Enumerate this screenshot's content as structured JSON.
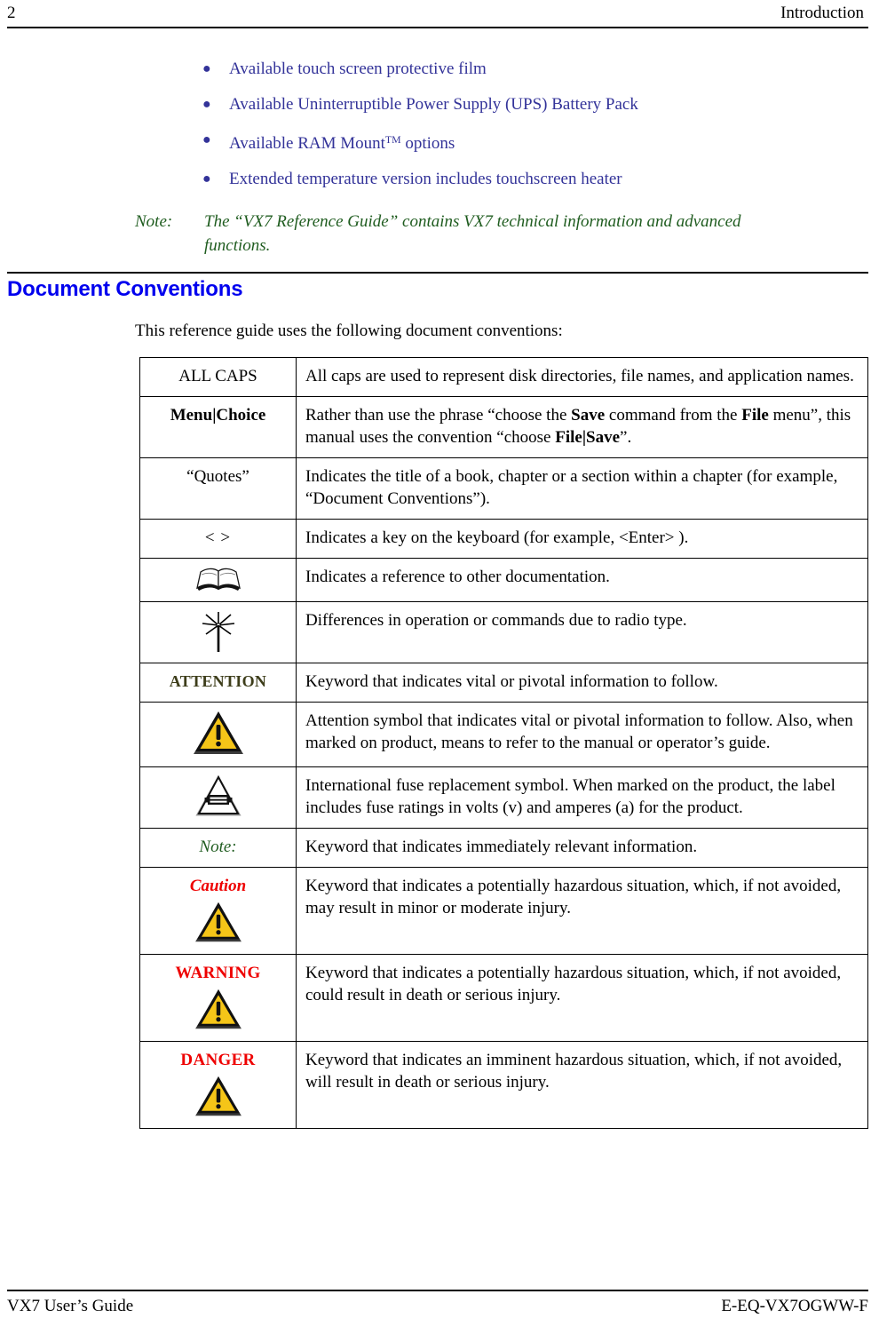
{
  "header": {
    "page_number": "2",
    "chapter_title": "Introduction"
  },
  "bullets": [
    {
      "text": "Available touch screen protective film"
    },
    {
      "text": "Available Uninterruptible Power Supply (UPS) Battery Pack"
    },
    {
      "text": "Available RAM Mount",
      "sup": "TM",
      "text_after": " options"
    },
    {
      "text": "Extended temperature version includes touchscreen heater"
    }
  ],
  "note": {
    "label": "Note:",
    "line1": "The “VX7 Reference Guide” contains VX7 technical information and advanced",
    "line2": "functions."
  },
  "section": {
    "heading": "Document Conventions",
    "intro": "This reference guide uses the following document conventions:"
  },
  "table": {
    "rows": [
      {
        "term": "ALL CAPS",
        "term_style": "plain",
        "icon": null,
        "desc": "All caps are used to represent disk directories, file names, and application names."
      },
      {
        "term": "Menu|Choice",
        "term_style": "bold",
        "icon": null,
        "desc": "Rather than use the phrase “choose the Save command from the File menu”, this manual uses the convention “choose File|Save”.",
        "desc_rich": [
          {
            "t": "Rather than use the phrase “choose the "
          },
          {
            "t": "Save",
            "b": true
          },
          {
            "t": " command from the "
          },
          {
            "t": "File",
            "b": true
          },
          {
            "t": " menu”, this manual uses the convention “choose "
          },
          {
            "t": "File|Save",
            "b": true
          },
          {
            "t": "”."
          }
        ]
      },
      {
        "term": "“Quotes”",
        "term_style": "plain",
        "icon": null,
        "desc": "Indicates the title of a book, chapter or a section within a chapter (for example, “Document Conventions”)."
      },
      {
        "term": "<     >",
        "term_style": "keys",
        "icon": null,
        "desc": "Indicates a key on the keyboard (for example, <Enter> )."
      },
      {
        "term": "",
        "term_style": "plain",
        "icon": "open-book-icon",
        "desc": "Indicates a reference to other documentation."
      },
      {
        "term": "",
        "term_style": "plain",
        "icon": "radio-antenna-icon",
        "desc": "Differences in operation or commands due to radio type."
      },
      {
        "term": "ATTENTION",
        "term_style": "attention",
        "icon": null,
        "desc": "Keyword that indicates vital or pivotal information to follow."
      },
      {
        "term": "",
        "term_style": "plain",
        "icon": "warning-triangle-icon",
        "desc": "Attention symbol that indicates vital or pivotal information to follow. Also, when marked on product, means to refer to the manual or operator’s guide."
      },
      {
        "term": "",
        "term_style": "plain",
        "icon": "fuse-triangle-icon",
        "desc": "International fuse replacement symbol. When marked on the product, the label includes fuse ratings in volts (v) and amperes (a) for the product."
      },
      {
        "term": "Note:",
        "term_style": "note",
        "icon": null,
        "desc": "Keyword that indicates immediately relevant information."
      },
      {
        "term": "Caution",
        "term_style": "caution",
        "icon": "warning-triangle-icon",
        "desc": "Keyword that indicates a potentially hazardous situation, which, if not avoided, may result in minor or moderate injury."
      },
      {
        "term": "WARNING",
        "term_style": "warning",
        "icon": "warning-triangle-icon",
        "desc": "Keyword that indicates a potentially hazardous situation, which, if not avoided, could result in death or serious injury."
      },
      {
        "term": "DANGER",
        "term_style": "danger",
        "icon": "warning-triangle-icon",
        "desc": "Keyword that indicates an imminent hazardous situation, which, if not avoided, will result in death or serious injury."
      }
    ]
  },
  "footer": {
    "left": "VX7 User’s Guide",
    "right": "E-EQ-VX7OGWW-F"
  },
  "colors": {
    "bullet_text": "#333399",
    "note_green": "#1f5c1f",
    "heading_blue": "#0000ee",
    "alert_red": "#ee0000",
    "attention_olive": "#3d3d1a",
    "warning_yellow": "#f5c518"
  }
}
